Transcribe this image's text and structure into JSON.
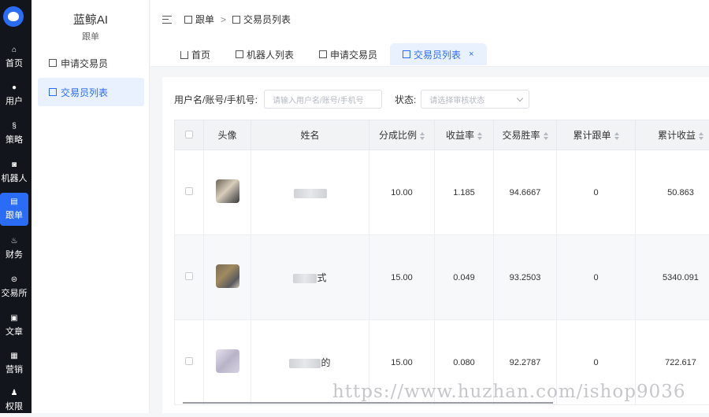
{
  "rail": {
    "logo": "app-logo",
    "items": [
      {
        "label": "首页",
        "icon": "home-icon"
      },
      {
        "label": "用户",
        "icon": "user-icon"
      },
      {
        "label": "策略",
        "icon": "strategy-icon"
      },
      {
        "label": "机器人",
        "icon": "robot-icon"
      },
      {
        "label": "跟单",
        "icon": "copy-trade-icon",
        "active": true
      },
      {
        "label": "财务",
        "icon": "finance-icon"
      },
      {
        "label": "交易所",
        "icon": "exchange-icon"
      },
      {
        "label": "文章",
        "icon": "article-icon"
      },
      {
        "label": "营销",
        "icon": "marketing-icon"
      },
      {
        "label": "权限",
        "icon": "permission-icon"
      }
    ]
  },
  "sidebar": {
    "brand": "蓝鲸AI",
    "section": "跟单",
    "items": [
      {
        "label": "申请交易员"
      },
      {
        "label": "交易员列表",
        "active": true
      }
    ]
  },
  "breadcrumb": {
    "parent": "跟单",
    "separator": ">",
    "current": "交易员列表"
  },
  "tabs": [
    {
      "label": "首页"
    },
    {
      "label": "机器人列表"
    },
    {
      "label": "申请交易员"
    },
    {
      "label": "交易员列表",
      "active": true,
      "close": "×"
    }
  ],
  "filters": {
    "search_label": "用户名/账号/手机号:",
    "search_placeholder": "请输入用户名/账号/手机号",
    "status_label": "状态:",
    "status_placeholder": "请选择审核状态"
  },
  "table": {
    "columns": [
      "头像",
      "姓名",
      "分成比例",
      "收益率",
      "交易胜率",
      "累计跟单",
      "累计收益"
    ],
    "rows": [
      {
        "name": "",
        "share": "10.00",
        "yield": "1.185",
        "win_rate": "94.6667",
        "follows": "0",
        "profit": "50.863"
      },
      {
        "name": "式",
        "share": "15.00",
        "yield": "0.049",
        "win_rate": "93.2503",
        "follows": "0",
        "profit": "5340.091"
      },
      {
        "name": "的",
        "share": "15.00",
        "yield": "0.080",
        "win_rate": "92.2787",
        "follows": "0",
        "profit": "722.617"
      }
    ]
  },
  "watermark": "https://www.huzhan.com/ishop9036",
  "colors": {
    "accent": "#2b6cf6",
    "rail_bg": "#12161c",
    "active_bg": "#e8f1fd"
  }
}
